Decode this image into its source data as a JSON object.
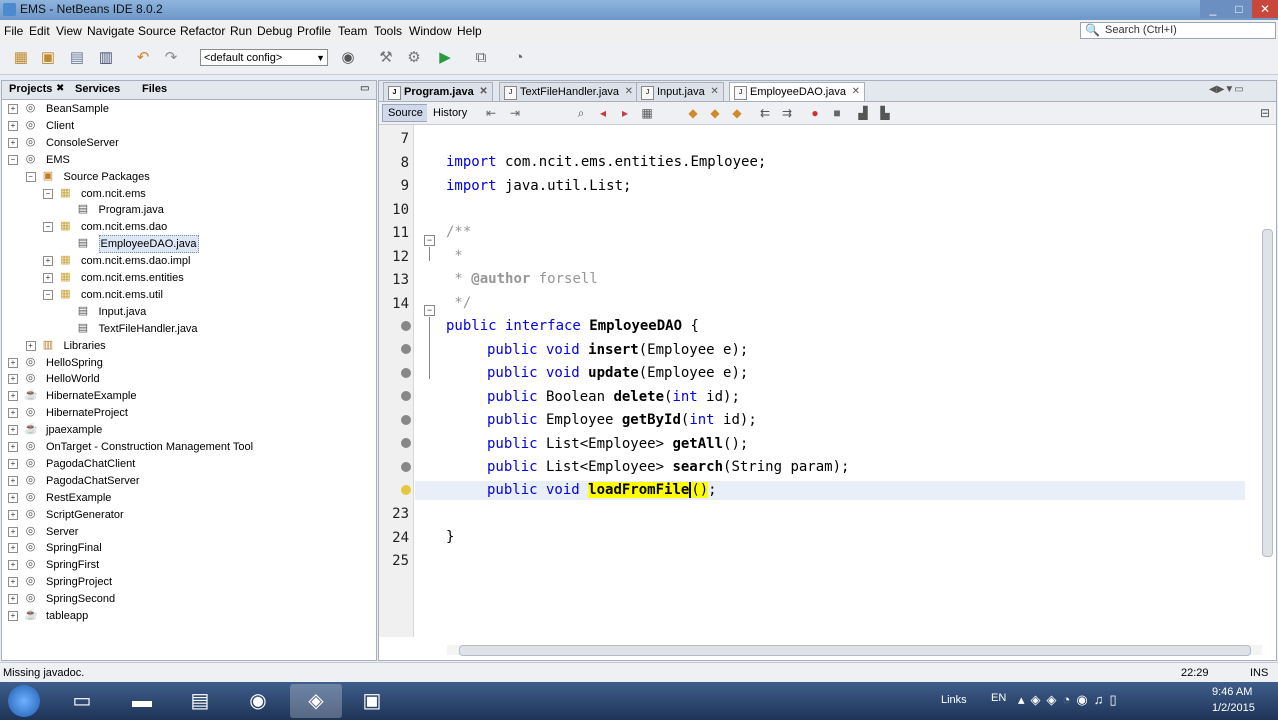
{
  "window": {
    "title": "EMS - NetBeans IDE 8.0.2",
    "controls": [
      "_",
      "□",
      "✕"
    ]
  },
  "menu": [
    "File",
    "Edit",
    "View",
    "Navigate",
    "Source",
    "Refactor",
    "Run",
    "Debug",
    "Profile",
    "Team",
    "Tools",
    "Window",
    "Help"
  ],
  "toolbar": {
    "config": "<default config>"
  },
  "search": {
    "placeholder": "Search (Ctrl+I)"
  },
  "left_tabs": [
    "Projects",
    "Services",
    "Files"
  ],
  "tree": [
    {
      "label": "BeanSample"
    },
    {
      "label": "Client"
    },
    {
      "label": "ConsoleServer"
    },
    {
      "label": "EMS"
    },
    {
      "label": "Source Packages"
    },
    {
      "label": "com.ncit.ems"
    },
    {
      "label": "Program.java"
    },
    {
      "label": "com.ncit.ems.dao"
    },
    {
      "label": "EmployeeDAO.java"
    },
    {
      "label": "com.ncit.ems.dao.impl"
    },
    {
      "label": "com.ncit.ems.entities"
    },
    {
      "label": "com.ncit.ems.util"
    },
    {
      "label": "Input.java"
    },
    {
      "label": "TextFileHandler.java"
    },
    {
      "label": "Libraries"
    },
    {
      "label": "HelloSpring"
    },
    {
      "label": "HelloWorld"
    },
    {
      "label": "HibernateExample"
    },
    {
      "label": "HibernateProject"
    },
    {
      "label": "jpaexample"
    },
    {
      "label": "OnTarget - Construction Management Tool"
    },
    {
      "label": "PagodaChatClient"
    },
    {
      "label": "PagodaChatServer"
    },
    {
      "label": "RestExample"
    },
    {
      "label": "ScriptGenerator"
    },
    {
      "label": "Server"
    },
    {
      "label": "SpringFinal"
    },
    {
      "label": "SpringFirst"
    },
    {
      "label": "SpringProject"
    },
    {
      "label": "SpringSecond"
    },
    {
      "label": "tableapp"
    }
  ],
  "editor_tabs": [
    "Program.java",
    "TextFileHandler.java",
    "Input.java",
    "EmployeeDAO.java"
  ],
  "editor_toolbar": {
    "source": "Source",
    "history": "History"
  },
  "code": {
    "line_numbers": [
      "7",
      "8",
      "9",
      "10",
      "11",
      "12",
      "13",
      "14",
      "",
      "",
      "",
      "",
      "",
      "",
      "",
      "23",
      "24",
      "25"
    ],
    "l8a": "import",
    "l8b": " com.ncit.ems.entities.Employee;",
    "l9a": "import",
    "l9b": " java.util.List;",
    "l11": "/**",
    "l12": " *",
    "l13a": " * ",
    "l13b": "@author",
    "l13c": " forsell",
    "l14": " */",
    "l15a": "public interface",
    "l15b": " ",
    "l15c": "EmployeeDAO",
    "l15d": " {",
    "m1a": "public void",
    "m1b": "insert",
    "m1c": "(Employee e);",
    "m2a": "public void",
    "m2b": "update",
    "m2c": "(Employee e);",
    "m3a": "public",
    "m3b": " Boolean ",
    "m3c": "delete",
    "m3d": "(",
    "m3e": "int",
    "m3f": " id);",
    "m4a": "public",
    "m4b": " Employee ",
    "m4c": "getById",
    "m4d": "(",
    "m4e": "int",
    "m4f": " id);",
    "m5a": "public",
    "m5b": " List<Employee> ",
    "m5c": "getAll",
    "m5d": "();",
    "m6a": "public",
    "m6b": " List<Employee> ",
    "m6c": "search",
    "m6d": "(String param);",
    "m7a": "public void",
    "m7b": "loadFromFile",
    "m7c": "()",
    "m7d": ";",
    "close": "}"
  },
  "status": {
    "message": "Missing javadoc.",
    "position": "22:29",
    "mode": "INS"
  },
  "taskbar": {
    "links": "Links",
    "lang": "EN",
    "time": "9:46 AM",
    "date": "1/2/2015"
  },
  "colors": {
    "keyword": "#0000e6",
    "comment": "#969696",
    "highlight": "#ffff00"
  }
}
